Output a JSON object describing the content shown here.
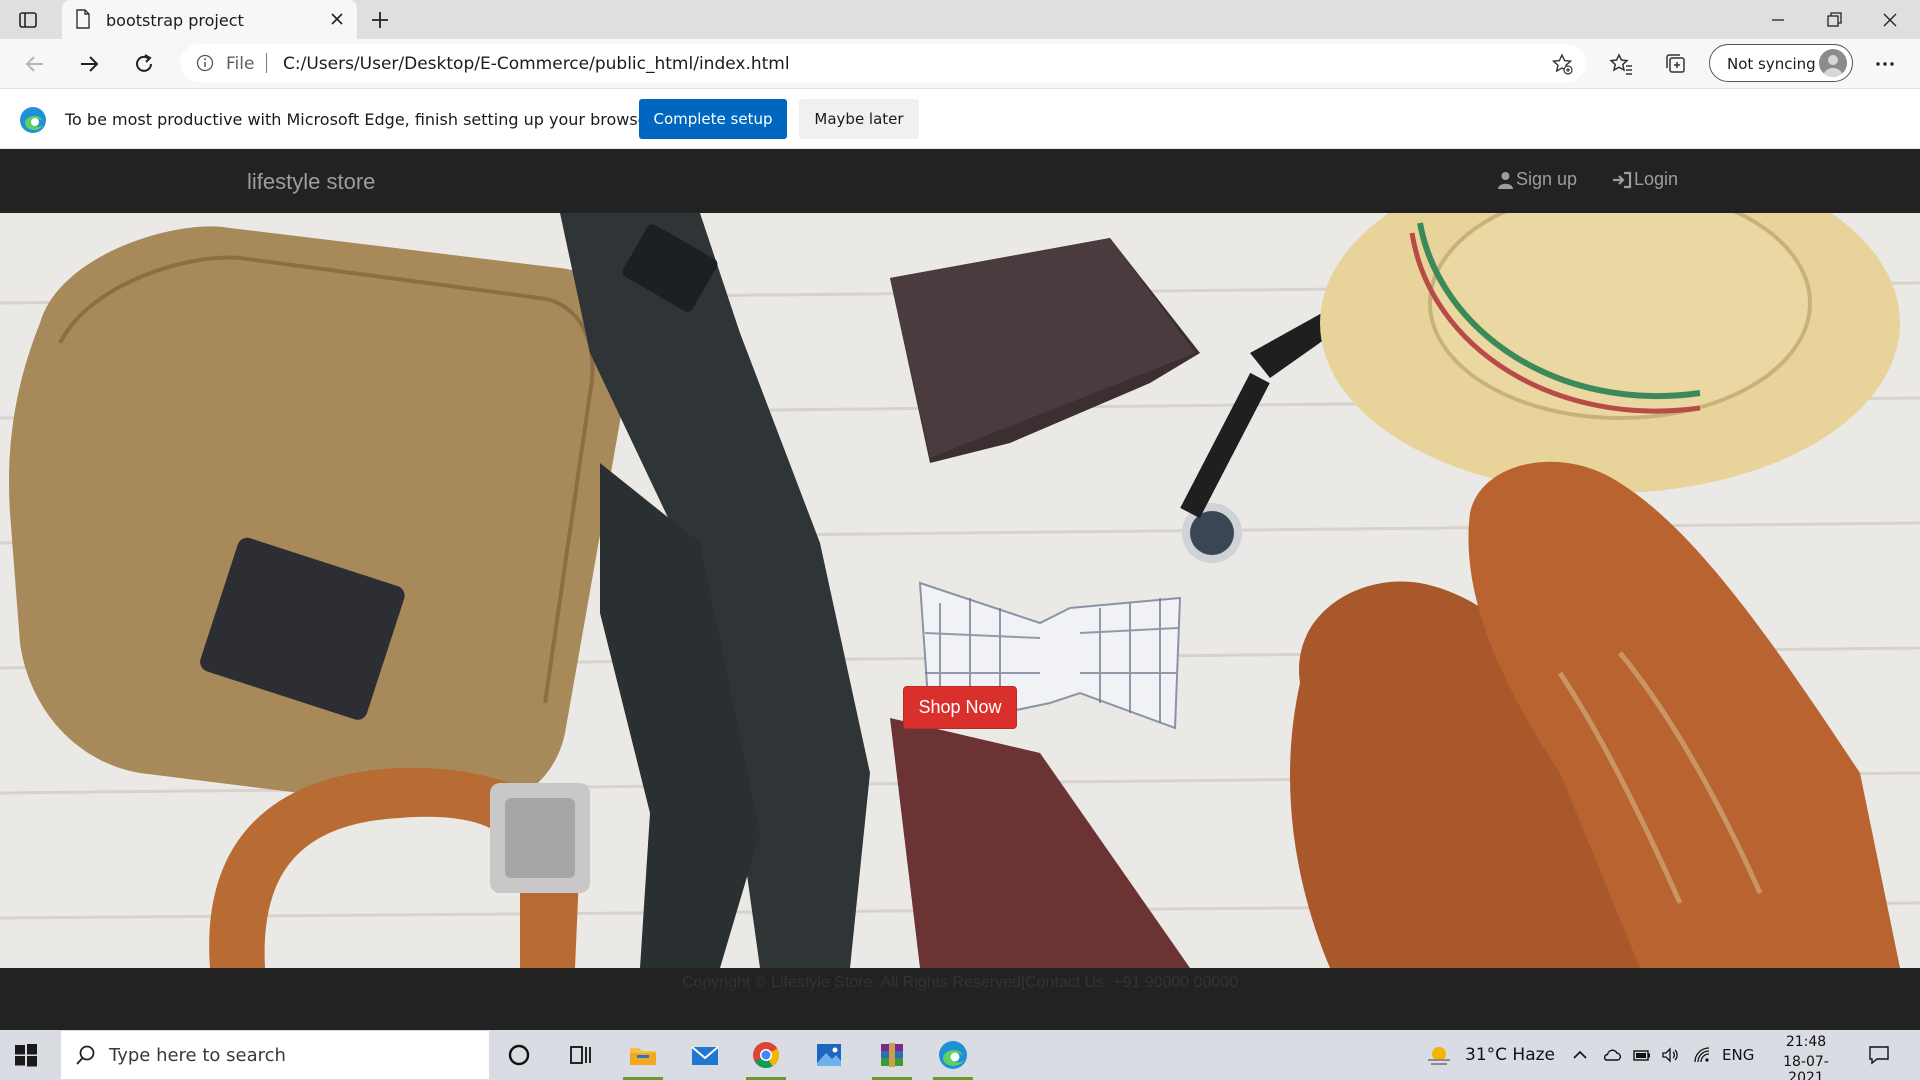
{
  "browser": {
    "tab_title": "bootstrap project",
    "scheme_label": "File",
    "url": "C:/Users/User/Desktop/E-Commerce/public_html/index.html",
    "profile_label": "Not syncing"
  },
  "infobar": {
    "message": "To be most productive with Microsoft Edge, finish setting up your browser.",
    "primary_button": "Complete setup",
    "secondary_button": "Maybe later"
  },
  "site": {
    "brand": "lifestyle store",
    "nav": {
      "signup": "Sign up",
      "login": "Login"
    },
    "hero_button": "Shop Now",
    "footer": "Copyright © Lifestyle Store. All Rights Reserved|Contact Us: +91 90000 00000"
  },
  "taskbar": {
    "search_placeholder": "Type here to search",
    "weather": "31°C  Haze",
    "language": "ENG",
    "time": "21:48",
    "date": "18-07-2021"
  },
  "colors": {
    "edge_blue": "#0067c0",
    "navbar_bg": "#222222",
    "shop_button": "#d9302b"
  }
}
